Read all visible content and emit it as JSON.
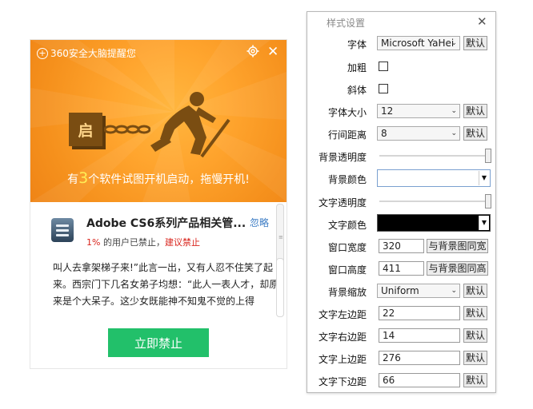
{
  "popup": {
    "brand": "360安全大脑提醒您",
    "banner_lock_char": "启",
    "banner_msg_prefix": "有",
    "banner_msg_count": "3",
    "banner_msg_suffix": "个软件试图开机启动，拖慢开机!",
    "app": {
      "title": "Adobe CS6系列产品相关管...",
      "ignore": "忽略",
      "percent": "1%",
      "disabled_text": " 的用户已禁止，",
      "advise": "建议禁止"
    },
    "description": "叫人去拿架梯子来!”此言一出，又有人忍不住笑了起来。西宗门下几名女弟子均想：“此人一表人才，却原来是个大呆子。这少女既能神不知鬼不觉的上得",
    "block_button": "立即禁止",
    "accent_color": "#22c06a",
    "banner_color": "#ffa52e"
  },
  "panel": {
    "title": "样式设置",
    "default_label": "默认",
    "rows": {
      "font": {
        "label": "字体",
        "value": "Microsoft YaHei"
      },
      "bold": {
        "label": "加粗"
      },
      "italic": {
        "label": "斜体"
      },
      "font_size": {
        "label": "字体大小",
        "value": "12"
      },
      "line_spacing": {
        "label": "行间距离",
        "value": "8"
      },
      "bg_opacity": {
        "label": "背景透明度",
        "value": 1.0
      },
      "bg_color": {
        "label": "背景颜色",
        "value": "#ffffff"
      },
      "text_opacity": {
        "label": "文字透明度",
        "value": 1.0
      },
      "text_color": {
        "label": "文字颜色",
        "value": "#000000"
      },
      "window_width": {
        "label": "窗口宽度",
        "value": "320",
        "button": "与背景图同宽"
      },
      "window_height": {
        "label": "窗口高度",
        "value": "411",
        "button": "与背景图同高"
      },
      "bg_scale": {
        "label": "背景缩放",
        "value": "Uniform"
      },
      "margin_left": {
        "label": "文字左边距",
        "value": "22"
      },
      "margin_right": {
        "label": "文字右边距",
        "value": "14"
      },
      "margin_top": {
        "label": "文字上边距",
        "value": "276"
      },
      "margin_bottom": {
        "label": "文字下边距",
        "value": "66"
      }
    }
  }
}
